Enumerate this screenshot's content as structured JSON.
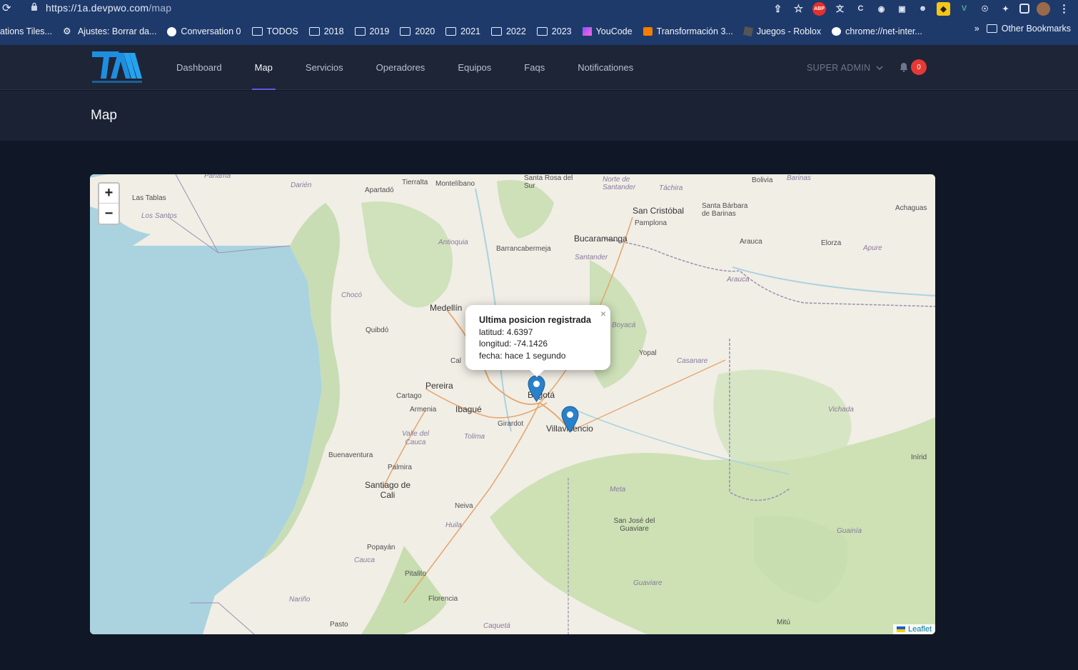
{
  "browser": {
    "url_host": "https://1a.devpwo.com",
    "url_path": "/map",
    "bookmarks": [
      "ations Tiles...",
      "Ajustes: Borrar da...",
      "Conversation 0",
      "TODOS",
      "2018",
      "2019",
      "2020",
      "2021",
      "2022",
      "2023",
      "YouCode",
      "Transformación 3...",
      "Juegos - Roblox",
      "chrome://net-inter..."
    ],
    "bookmarks_more": "»",
    "other_bookmarks": "Other Bookmarks"
  },
  "nav": {
    "items": [
      "Dashboard",
      "Map",
      "Servicios",
      "Operadores",
      "Equipos",
      "Faqs",
      "Notificationes"
    ],
    "active": "Map",
    "user": "SUPER ADMIN",
    "notification_count": "0"
  },
  "page": {
    "title": "Map"
  },
  "map": {
    "zoom_in": "+",
    "zoom_out": "−",
    "attribution": "Leaflet",
    "popup": {
      "title": "Ultima posicion registrada",
      "lat_line": "latitud: 4.6397",
      "lng_line": "longitud: -74.1426",
      "date_line": "fecha: hace 1 segundo",
      "close": "×"
    },
    "markers": [
      {
        "name": "Bogotá",
        "lat": 4.6397,
        "lng": -74.1426
      },
      {
        "name": "Villavicencio"
      }
    ],
    "labels": {
      "panama": "Panamá",
      "darien": "Darién",
      "apartado": "Apartadó",
      "tierralta": "Tierralta",
      "montelibano": "Montelíbano",
      "santa_rosa": "Santa Rosa del Sur",
      "norte_santander": "Norte de Santander",
      "tachira": "Táchira",
      "bolivia": "Bolivia",
      "barinas": "Barinas",
      "las_tablas": "Las Tablas",
      "los_santos": "Los Santos",
      "san_cristobal": "San Cristóbal",
      "santa_barbara": "Santa Bárbara de Barinas",
      "achaguas": "Achaguas",
      "pamplona": "Pamplona",
      "bucaramanga": "Bucaramanga",
      "antioquia": "Antioquia",
      "barrancabermeja": "Barrancabermeja",
      "santander": "Santander",
      "arauca_city": "Arauca",
      "elorza": "Elorza",
      "apure": "Apure",
      "arauca_region": "Arauca",
      "choco": "Chocó",
      "medellin": "Medellín",
      "quibdo": "Quibdó",
      "boyaca": "Boyacá",
      "yopal": "Yopal",
      "casanare": "Casanare",
      "caldas": "Cal",
      "pereira": "Pereira",
      "cartago": "Cartago",
      "armenia": "Armenia",
      "ibague": "Ibagué",
      "bogota": "Bogotá",
      "girardot": "Girardot",
      "villavicencio": "Villavicencio",
      "vichada": "Vichada",
      "valle": "Valle del Cauca",
      "tolima": "Tolima",
      "buenaventura": "Buenaventura",
      "inirida": "Inírid",
      "palmira": "Palmira",
      "cali": "Santiago de Cali",
      "meta": "Meta",
      "neiva": "Neiva",
      "huila": "Huila",
      "san_jose": "San José del Guaviare",
      "guainia": "Guainía",
      "popayan": "Popayán",
      "cauca": "Cauca",
      "pitalito": "Pitalito",
      "guaviare": "Guaviare",
      "narino": "Nariño",
      "florencia": "Florencia",
      "pasto": "Pasto",
      "caqueta": "Caquetá",
      "mitu": "Mitú"
    }
  }
}
